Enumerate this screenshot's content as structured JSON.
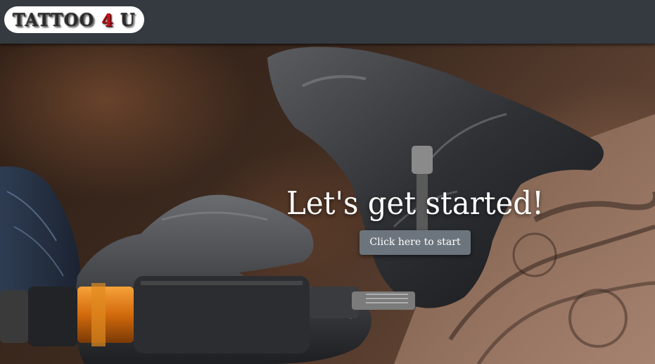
{
  "navbar": {
    "logo_prefix": "TATTOO ",
    "logo_accent": "4",
    "logo_suffix": " U"
  },
  "hero": {
    "heading": "Let's get started!",
    "button_label": "Click here to start"
  },
  "colors": {
    "navbar_bg": "#343a40",
    "button_bg": "#6c757d",
    "logo_accent": "#c0141b"
  }
}
